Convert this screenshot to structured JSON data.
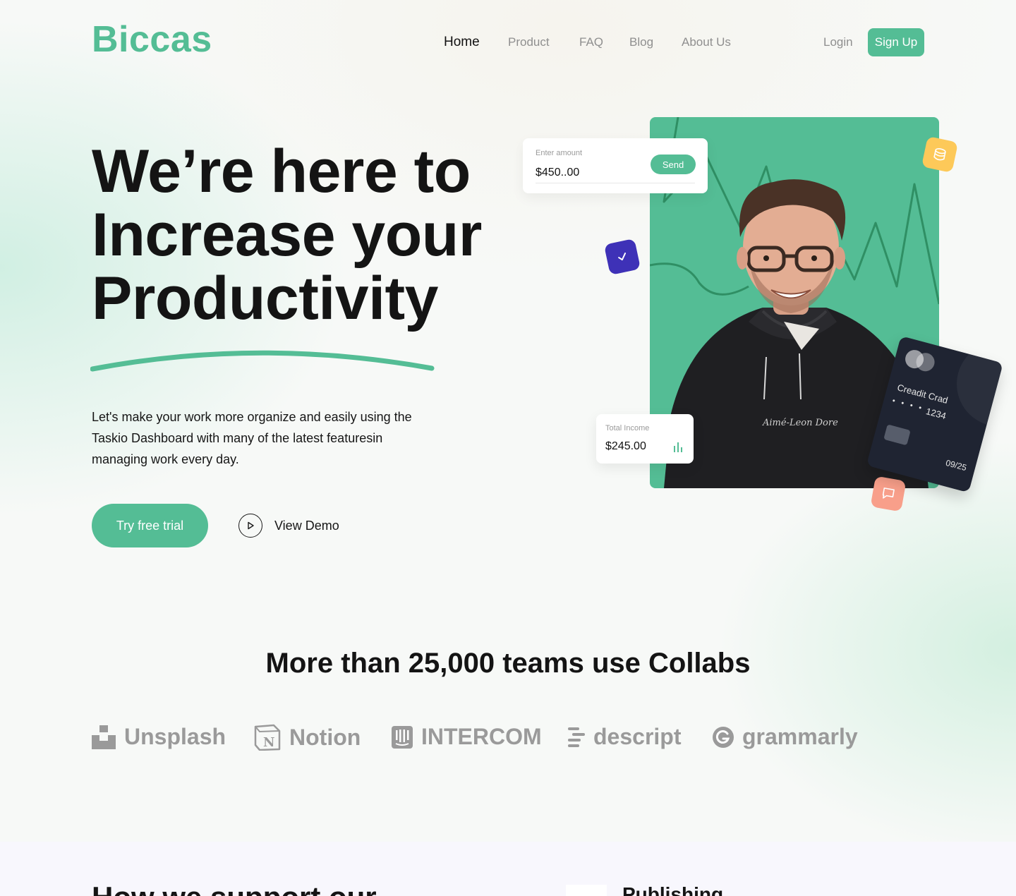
{
  "header": {
    "logo": "Biccas",
    "nav": [
      {
        "label": "Home",
        "active": true
      },
      {
        "label": "Product",
        "active": false
      },
      {
        "label": "FAQ",
        "active": false
      },
      {
        "label": "Blog",
        "active": false
      },
      {
        "label": "About Us",
        "active": false
      }
    ],
    "login": "Login",
    "signup": "Sign Up"
  },
  "hero": {
    "headline": [
      "We’re here to",
      "Increase your",
      "Productivity"
    ],
    "subtext": "Let's make your work more organize and easily using the Taskio Dashboard with many of the latest featuresin managing work every day.",
    "cta": "Try free trial",
    "demo": "View Demo"
  },
  "visual": {
    "amount_label": "Enter amount",
    "amount_value": "$450..00",
    "send": "Send",
    "income_label": "Total Income",
    "income_value": "$245.00",
    "card_title": "Creadit Crad",
    "card_dots": "• • • •",
    "card_number": "1234",
    "card_expiry": "09/25",
    "hoodie_text": "Aimé-Leon Dore"
  },
  "collab": {
    "title": "More than 25,000 teams use Collabs",
    "brands": [
      {
        "name": "Unsplash",
        "icon": "unsplash-icon"
      },
      {
        "name": "Notion",
        "icon": "notion-icon"
      },
      {
        "name": "INTERCOM",
        "icon": "intercom-icon"
      },
      {
        "name": "descript",
        "icon": "descript-icon"
      },
      {
        "name": "grammarly",
        "icon": "grammarly-icon"
      }
    ]
  },
  "next_section": {
    "title": "How we support our",
    "side_title": "Publishing"
  },
  "colors": {
    "brand": "#54bd95",
    "dark": "#141414",
    "muted": "#9a9a9a",
    "purple": "#3e31b7",
    "yellow": "#fdc959",
    "salmon": "#f89f8a"
  }
}
